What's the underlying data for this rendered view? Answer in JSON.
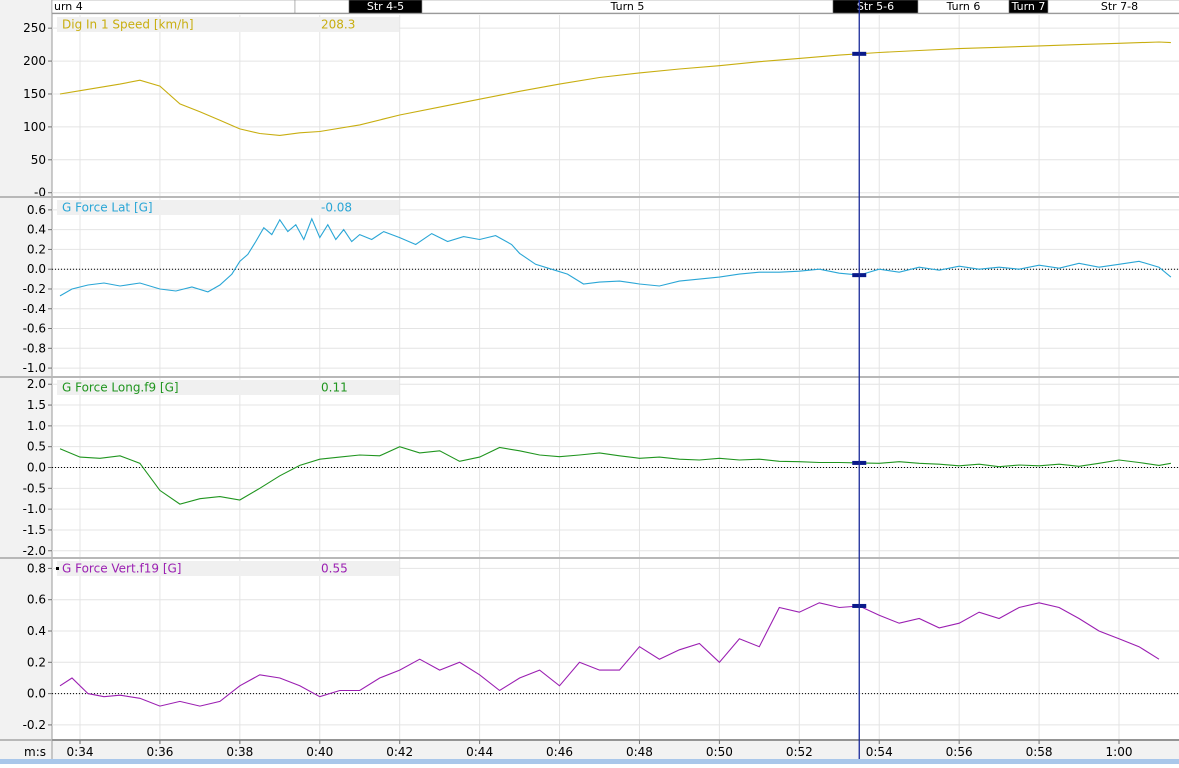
{
  "segments": [
    {
      "label": "urn 4",
      "dark": false
    },
    {
      "label": "",
      "dark": false
    },
    {
      "label": "Str 4-5",
      "dark": true
    },
    {
      "label": "Turn 5",
      "dark": false
    },
    {
      "label": "Str 5-6",
      "dark": true
    },
    {
      "label": "Turn 6",
      "dark": false
    },
    {
      "label": "Turn 7",
      "dark": true
    },
    {
      "label": "Str 7-8",
      "dark": false
    },
    {
      "label": "",
      "dark": true
    },
    {
      "label": "",
      "dark": false
    }
  ],
  "x_axis": {
    "unit_label": "m:s",
    "ticks": [
      "0:34",
      "0:36",
      "0:38",
      "0:40",
      "0:42",
      "0:44",
      "0:46",
      "0:48",
      "0:50",
      "0:52",
      "0:54",
      "0:56",
      "0:58",
      "1:00"
    ]
  },
  "cursor": {
    "time": "0:53.5"
  },
  "chart_data": [
    {
      "type": "line",
      "series": [
        {
          "name": "Dig In 1 Speed [km/h]",
          "color": "#c8ae10"
        }
      ],
      "cursor_value": "208.3",
      "ylim": [
        -5,
        270
      ],
      "yticks": [
        "250",
        "200",
        "150",
        "100",
        "50",
        "-0"
      ],
      "zero_line": false,
      "x": [
        33.5,
        34.0,
        35.0,
        35.5,
        36.0,
        36.5,
        37.0,
        37.5,
        38.0,
        38.5,
        39.0,
        39.5,
        40.0,
        41.0,
        42.0,
        43.0,
        44.0,
        45.0,
        46.0,
        47.0,
        48.0,
        49.0,
        50.0,
        51.0,
        52.0,
        53.0,
        54.0,
        55.0,
        56.0,
        57.0,
        58.0,
        59.0,
        60.0,
        61.0,
        61.3
      ],
      "y": [
        150,
        155,
        165,
        171,
        162,
        135,
        123,
        110,
        97,
        90,
        87,
        91,
        93,
        103,
        118,
        130,
        142,
        154,
        165,
        175,
        182,
        188,
        193,
        199,
        204,
        209,
        213,
        216,
        219,
        221,
        223,
        225,
        227,
        229,
        228
      ]
    },
    {
      "type": "line",
      "series": [
        {
          "name": "G Force Lat [G]",
          "color": "#2aa6d6"
        }
      ],
      "cursor_value": "-0.08",
      "ylim": [
        -1.08,
        0.72
      ],
      "yticks": [
        "0.6",
        "0.4",
        "0.2",
        "0.0",
        "-0.2",
        "-0.4",
        "-0.6",
        "-0.8",
        "-1.0"
      ],
      "zero_line": true,
      "x": [
        33.5,
        33.8,
        34.2,
        34.6,
        35.0,
        35.5,
        36.0,
        36.4,
        36.8,
        37.2,
        37.5,
        37.8,
        38.0,
        38.2,
        38.4,
        38.6,
        38.8,
        39.0,
        39.2,
        39.4,
        39.6,
        39.8,
        40.0,
        40.2,
        40.4,
        40.6,
        40.8,
        41.0,
        41.3,
        41.6,
        42.0,
        42.4,
        42.8,
        43.2,
        43.6,
        44.0,
        44.4,
        44.8,
        45.0,
        45.4,
        45.8,
        46.2,
        46.6,
        47.0,
        47.5,
        48.0,
        48.5,
        49.0,
        49.5,
        50.0,
        50.5,
        51.0,
        51.5,
        52.0,
        52.5,
        53.0,
        53.5,
        54.0,
        54.5,
        55.0,
        55.5,
        56.0,
        56.5,
        57.0,
        57.5,
        58.0,
        58.5,
        59.0,
        59.5,
        60.0,
        60.5,
        61.0,
        61.3
      ],
      "y": [
        -0.27,
        -0.2,
        -0.16,
        -0.14,
        -0.17,
        -0.14,
        -0.2,
        -0.22,
        -0.18,
        -0.23,
        -0.16,
        -0.05,
        0.08,
        0.15,
        0.28,
        0.42,
        0.35,
        0.5,
        0.38,
        0.45,
        0.3,
        0.51,
        0.32,
        0.45,
        0.3,
        0.4,
        0.28,
        0.35,
        0.3,
        0.38,
        0.32,
        0.25,
        0.36,
        0.28,
        0.33,
        0.3,
        0.34,
        0.25,
        0.16,
        0.05,
        0.0,
        -0.05,
        -0.15,
        -0.13,
        -0.12,
        -0.15,
        -0.17,
        -0.12,
        -0.1,
        -0.08,
        -0.05,
        -0.03,
        -0.03,
        -0.02,
        0.0,
        -0.04,
        -0.06,
        0.0,
        -0.03,
        0.02,
        -0.01,
        0.03,
        0.0,
        0.02,
        0.0,
        0.04,
        0.01,
        0.06,
        0.02,
        0.05,
        0.08,
        0.02,
        -0.08
      ]
    },
    {
      "type": "line",
      "series": [
        {
          "name": "G Force Long.f9 [G]",
          "color": "#20951f"
        }
      ],
      "cursor_value": "0.11",
      "ylim": [
        -2.15,
        2.15
      ],
      "yticks": [
        "2.0",
        "1.5",
        "1.0",
        "0.5",
        "0.0",
        "-0.5",
        "-1.0",
        "-1.5",
        "-2.0"
      ],
      "zero_line": true,
      "x": [
        33.5,
        34.0,
        34.5,
        35.0,
        35.5,
        36.0,
        36.5,
        37.0,
        37.5,
        38.0,
        38.5,
        39.0,
        39.5,
        40.0,
        40.5,
        41.0,
        41.5,
        42.0,
        42.5,
        43.0,
        43.5,
        44.0,
        44.5,
        45.0,
        45.5,
        46.0,
        46.5,
        47.0,
        47.5,
        48.0,
        48.5,
        49.0,
        49.5,
        50.0,
        50.5,
        51.0,
        51.5,
        52.0,
        52.5,
        53.0,
        53.5,
        54.0,
        54.5,
        55.0,
        55.5,
        56.0,
        56.5,
        57.0,
        57.5,
        58.0,
        58.5,
        59.0,
        59.5,
        60.0,
        60.5,
        61.0,
        61.3
      ],
      "y": [
        0.45,
        0.25,
        0.22,
        0.28,
        0.1,
        -0.55,
        -0.88,
        -0.75,
        -0.7,
        -0.78,
        -0.5,
        -0.2,
        0.05,
        0.2,
        0.25,
        0.3,
        0.28,
        0.5,
        0.35,
        0.4,
        0.15,
        0.25,
        0.48,
        0.4,
        0.3,
        0.26,
        0.3,
        0.35,
        0.28,
        0.22,
        0.25,
        0.2,
        0.18,
        0.22,
        0.18,
        0.2,
        0.15,
        0.14,
        0.12,
        0.12,
        0.11,
        0.1,
        0.14,
        0.1,
        0.08,
        0.04,
        0.08,
        0.02,
        0.06,
        0.04,
        0.08,
        0.03,
        0.1,
        0.18,
        0.12,
        0.05,
        0.1
      ]
    },
    {
      "type": "line",
      "series": [
        {
          "name": "G Force Vert.f19 [G]",
          "color": "#9b1fb2"
        }
      ],
      "cursor_value": "0.55",
      "ylim": [
        -0.29,
        0.86
      ],
      "yticks": [
        "0.8",
        "0.6",
        "0.4",
        "0.2",
        "0.0",
        "-0.2"
      ],
      "zero_line": true,
      "x": [
        33.5,
        33.8,
        34.2,
        34.6,
        35.0,
        35.5,
        36.0,
        36.5,
        37.0,
        37.5,
        38.0,
        38.5,
        39.0,
        39.5,
        40.0,
        40.5,
        41.0,
        41.5,
        42.0,
        42.5,
        43.0,
        43.5,
        44.0,
        44.5,
        45.0,
        45.5,
        46.0,
        46.5,
        47.0,
        47.5,
        48.0,
        48.5,
        49.0,
        49.5,
        50.0,
        50.5,
        51.0,
        51.5,
        52.0,
        52.5,
        53.0,
        53.5,
        54.0,
        54.5,
        55.0,
        55.5,
        56.0,
        56.5,
        57.0,
        57.5,
        58.0,
        58.5,
        59.0,
        59.5,
        60.0,
        60.5,
        61.0,
        61.3
      ],
      "y": [
        0.05,
        0.1,
        0.0,
        -0.02,
        -0.01,
        -0.03,
        -0.08,
        -0.05,
        -0.08,
        -0.05,
        0.05,
        0.12,
        0.1,
        0.05,
        -0.02,
        0.02,
        0.02,
        0.1,
        0.15,
        0.22,
        0.15,
        0.2,
        0.12,
        0.02,
        0.1,
        0.15,
        0.05,
        0.2,
        0.15,
        0.15,
        0.3,
        0.22,
        0.28,
        0.32,
        0.2,
        0.35,
        0.3,
        0.55,
        0.52,
        0.58,
        0.55,
        0.56,
        0.5,
        0.45,
        0.48,
        0.42,
        0.45,
        0.52,
        0.48,
        0.55,
        0.58,
        0.55,
        0.48,
        0.4,
        0.35,
        0.3,
        0.22
      ]
    }
  ]
}
